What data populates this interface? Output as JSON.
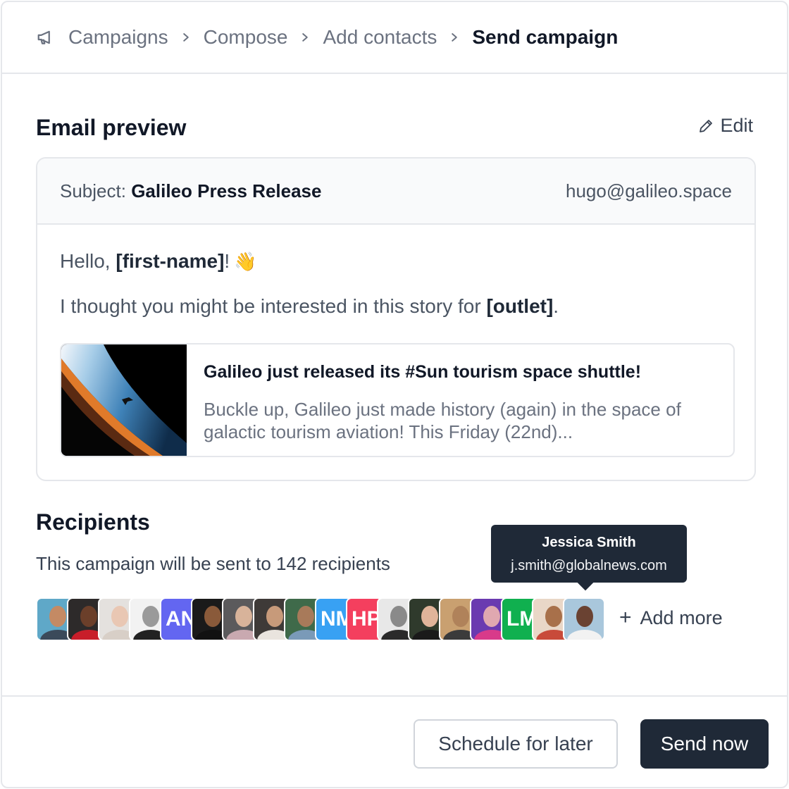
{
  "breadcrumb": {
    "items": [
      "Campaigns",
      "Compose",
      "Add contacts"
    ],
    "current": "Send campaign"
  },
  "email_preview": {
    "title": "Email preview",
    "edit_label": "Edit",
    "subject_label": "Subject:",
    "subject": "Galileo Press Release",
    "sender": "hugo@galileo.space",
    "greeting_prefix": "Hello, ",
    "greeting_var": "[first-name]",
    "greeting_suffix": "!",
    "greeting_emoji": "👋",
    "body_prefix": "I thought you might be interested in this story for ",
    "body_var": "[outlet]",
    "body_suffix": ".",
    "article": {
      "title": "Galileo just released its #Sun tourism space shuttle!",
      "description": "Buckle up, Galileo just made history (again) in the space of galactic tourism aviation! This Friday (22nd)..."
    }
  },
  "recipients": {
    "title": "Recipients",
    "description": "This campaign will be sent to 142 recipients",
    "add_more_label": "Add more",
    "avatars": [
      {
        "type": "photo",
        "bg": "#5fa8c8",
        "skin": "#c48a64",
        "cloth": "#3b4a5a"
      },
      {
        "type": "photo",
        "bg": "#2d2a2a",
        "skin": "#6b3f2a",
        "cloth": "#c81e2a"
      },
      {
        "type": "photo",
        "bg": "#e4e1de",
        "skin": "#e9c7b3",
        "cloth": "#d8cfc7"
      },
      {
        "type": "photo",
        "bg": "#f2f2f2",
        "skin": "#9a9a9a",
        "cloth": "#222222"
      },
      {
        "type": "initials",
        "text": "AN",
        "bg": "#6366f1"
      },
      {
        "type": "photo",
        "bg": "#1a1a1a",
        "skin": "#8a5a3a",
        "cloth": "#111111"
      },
      {
        "type": "photo",
        "bg": "#5b5a5c",
        "skin": "#d8b39a",
        "cloth": "#c9a9b0"
      },
      {
        "type": "photo",
        "bg": "#3e3a38",
        "skin": "#c79a7a",
        "cloth": "#e9e4de"
      },
      {
        "type": "photo",
        "bg": "#3f6a4a",
        "skin": "#a87a5a",
        "cloth": "#7a9ab8"
      },
      {
        "type": "initials",
        "text": "NM",
        "bg": "#38a1f3"
      },
      {
        "type": "initials",
        "text": "HP",
        "bg": "#f43f5e"
      },
      {
        "type": "photo",
        "bg": "#e8e8e8",
        "skin": "#8a8a8a",
        "cloth": "#2a2a2a"
      },
      {
        "type": "photo",
        "bg": "#2f3a2c",
        "skin": "#e0b49a",
        "cloth": "#1a1a1a"
      },
      {
        "type": "photo",
        "bg": "#c9a070",
        "skin": "#b0825a",
        "cloth": "#3b3b3b"
      },
      {
        "type": "photo",
        "bg": "#6a3ab0",
        "skin": "#e0a8b0",
        "cloth": "#d83a8a"
      },
      {
        "type": "initials",
        "text": "LM",
        "bg": "#10b04f"
      },
      {
        "type": "photo",
        "bg": "#e9d7c7",
        "skin": "#a8704a",
        "cloth": "#c84a3a"
      },
      {
        "type": "photo",
        "bg": "#a9c7dc",
        "skin": "#6a4232",
        "cloth": "#f2f2f2"
      }
    ],
    "tooltip": {
      "name": "Jessica Smith",
      "email": "j.smith@globalnews.com"
    }
  },
  "footer": {
    "schedule_label": "Schedule for later",
    "send_label": "Send now"
  }
}
